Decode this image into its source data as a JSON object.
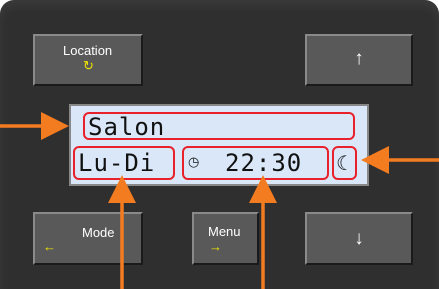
{
  "buttons": {
    "location": {
      "label": "Location",
      "icon": "rotate-icon",
      "glyph": "↻"
    },
    "up": {
      "glyph": "↑"
    },
    "mode": {
      "label": "Mode",
      "glyph": "←"
    },
    "menu": {
      "label": "Menu",
      "glyph": "→"
    },
    "down": {
      "glyph": "↓"
    }
  },
  "lcd": {
    "room": "Salon",
    "days": "Lu-Di",
    "clock_icon": "◷",
    "time": "22:30",
    "mode_icon": "☾"
  },
  "colors": {
    "panel": "#2f2f2f",
    "button": "#595959",
    "lcd_background": "#d9e7f8",
    "highlight_box": "#e8212b",
    "callout_arrow": "#f47c20",
    "accent_glyph": "#f2e400"
  }
}
